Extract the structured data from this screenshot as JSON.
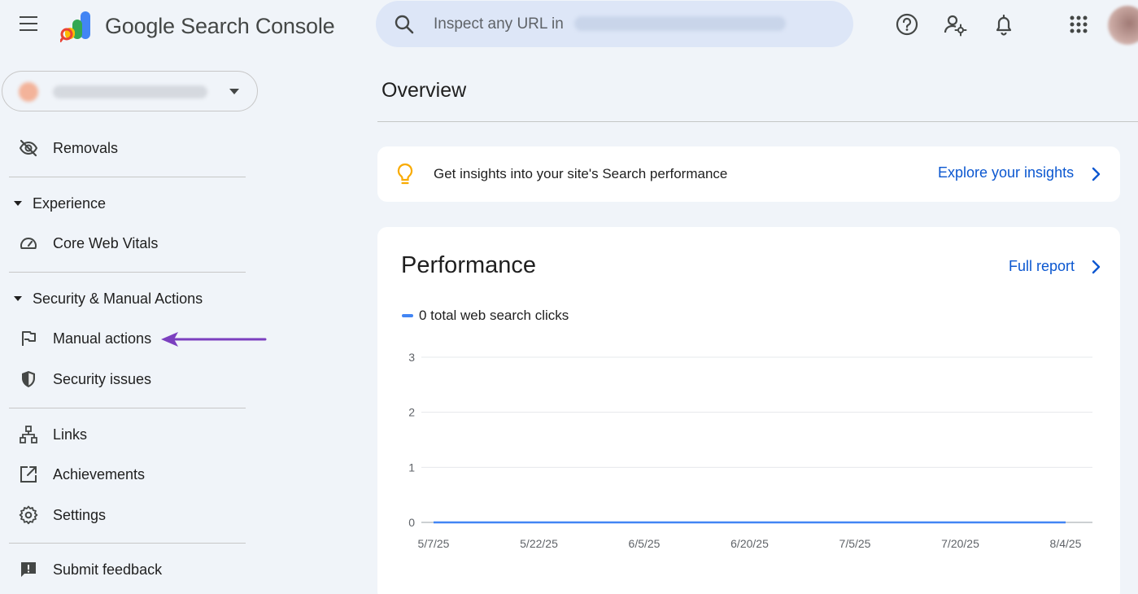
{
  "app": {
    "title": "Google Search Console"
  },
  "search": {
    "placeholder": "Inspect any URL in"
  },
  "header_icons": [
    "help-icon",
    "manage-users-icon",
    "notifications-icon",
    "apps-grid-icon"
  ],
  "sidebar": {
    "items_top": [
      {
        "label": "Removals",
        "icon": "eye-off-icon"
      }
    ],
    "sections": [
      {
        "label": "Experience",
        "items": [
          {
            "label": "Core Web Vitals",
            "icon": "speedometer-icon"
          }
        ]
      },
      {
        "label": "Security & Manual Actions",
        "items": [
          {
            "label": "Manual actions",
            "icon": "flag-icon"
          },
          {
            "label": "Security issues",
            "icon": "shield-icon"
          }
        ]
      }
    ],
    "items_bottom": [
      {
        "label": "Links",
        "icon": "sitemap-icon"
      },
      {
        "label": "Achievements",
        "icon": "open-in-new-icon"
      },
      {
        "label": "Settings",
        "icon": "gear-icon"
      }
    ],
    "feedback": {
      "label": "Submit feedback",
      "icon": "feedback-icon"
    }
  },
  "main": {
    "title": "Overview",
    "insights": {
      "text": "Get insights into your site's Search performance",
      "link": "Explore your insights"
    },
    "performance": {
      "title": "Performance",
      "link": "Full report"
    }
  },
  "colors": {
    "accent": "#0b57d0",
    "series": "#4285f4",
    "annotation_arrow": "#7b3fbf",
    "background": "#f0f4f9"
  },
  "chart_data": {
    "type": "line",
    "series": [
      {
        "name": "0 total web search clicks",
        "values": [
          0,
          0,
          0,
          0,
          0,
          0,
          0
        ]
      }
    ],
    "x": [
      "5/7/25",
      "5/22/25",
      "6/5/25",
      "6/20/25",
      "7/5/25",
      "7/20/25",
      "8/4/25"
    ],
    "y_ticks": [
      0,
      1,
      2,
      3
    ],
    "ylim": [
      0,
      3
    ],
    "grid": true,
    "legend": "top-left"
  }
}
